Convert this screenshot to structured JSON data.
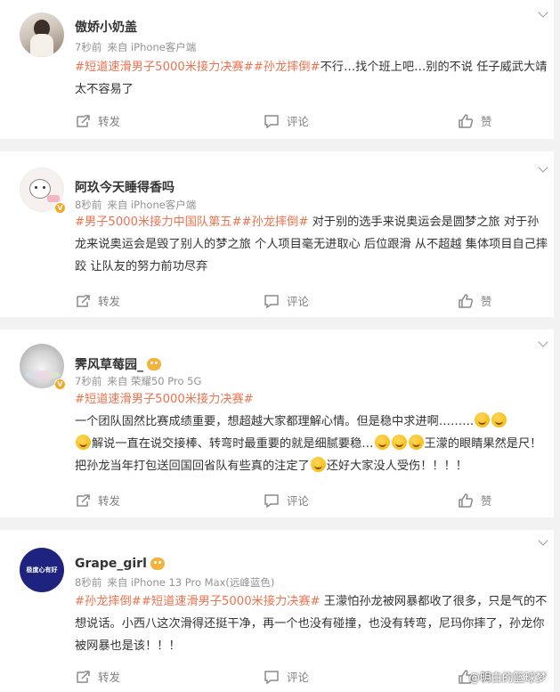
{
  "posts": [
    {
      "name": "傲娇小奶盖",
      "time": "7秒前",
      "source": "来自 iPhone客户端",
      "tags": "#短道速滑男子5000米接力决赛##孙龙摔倒#",
      "text": "不行…找个班上吧…别的不说 任子威武大靖太不容易了",
      "repost": "转发",
      "comment": "评论",
      "like": "赞"
    },
    {
      "name": "阿玖今天睡得香吗",
      "time": "8秒前",
      "source": "来自 iPhone客户端",
      "tags": "#男子5000米接力中国队第五##孙龙摔倒#",
      "text": " 对于别的选手来说奥运会是圆梦之旅 对于孙龙来说奥运会是毁了别人的梦之旅 个人项目毫无进取心 后位跟滑 从不超越 集体项目自己摔跤 让队友的努力前功尽弃",
      "repost": "转发",
      "comment": "评论",
      "like": "赞"
    },
    {
      "name": "霁风草莓园_",
      "time": "7秒前",
      "source": "来自 荣耀50 Pro 5G",
      "tags": "#短道速滑男子5000米接力决赛#",
      "text1": "一个团队固然比赛成绩重要，想超越大家都理解心情。但是稳中求进啊………",
      "text2": "解说一直在说交接棒、转弯时最重要的就是细腻要稳…",
      "text3": "王濛的眼睛果然是尺！把孙龙当年打包送回国回省队有些真的注定了",
      "text4": "还好大家没人受伤！！！！",
      "repost": "转发",
      "comment": "评论",
      "like": "赞"
    },
    {
      "name": "Grape_girl",
      "time": "8秒前",
      "source": "来自 iPhone 13 Pro Max(远峰蓝色)",
      "avatar_text": "极度心有好",
      "tags": "#孙龙摔倒##短道速滑男子5000米接力决赛#",
      "text": " 王濛怕孙龙被网暴都收了很多，只是气的不想说话。小西八这次滑得还挺干净，再一个也没有碰撞，也没有转弯，尼玛你摔了，孙龙你被网暴也是该！！！",
      "repost": "转发",
      "comment": "评论",
      "like": "赞"
    }
  ],
  "watermark": "@明白的篮球梦",
  "colors": {
    "tag": "#eb7350",
    "meta": "#939393",
    "bg": "#f2f2f2"
  }
}
